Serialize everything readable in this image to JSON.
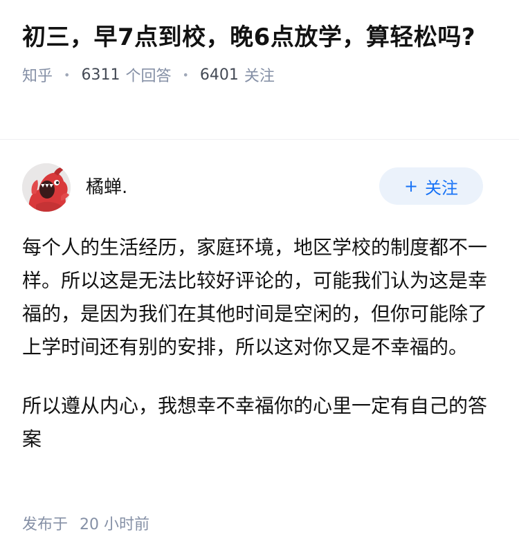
{
  "question": {
    "title": "初三，早7点到校，晚6点放学，算轻松吗?",
    "source": "知乎",
    "answers_count": "6311",
    "answers_label": "个回答",
    "followers_count": "6401",
    "followers_label": "关注"
  },
  "answer": {
    "author_name": "橘蝉.",
    "follow_button": {
      "icon": "plus-icon",
      "label": "关注"
    },
    "paragraphs": [
      "每个人的生活经历，家庭环境，地区学校的制度都不一样。所以这是无法比较好评论的，可能我们认为这是幸福的，是因为我们在其他时间是空闲的，但你可能除了上学时间还有别的安排，所以这对你又是不幸福的。",
      "所以遵从内心，我想幸不幸福你的心里一定有自己的答案"
    ],
    "published_prefix": "发布于",
    "published_time": "20 小时前"
  },
  "colors": {
    "accent": "#1772f6",
    "follow_bg": "#ebf2fb",
    "meta_text": "#8590a6",
    "body_text": "#121212"
  }
}
